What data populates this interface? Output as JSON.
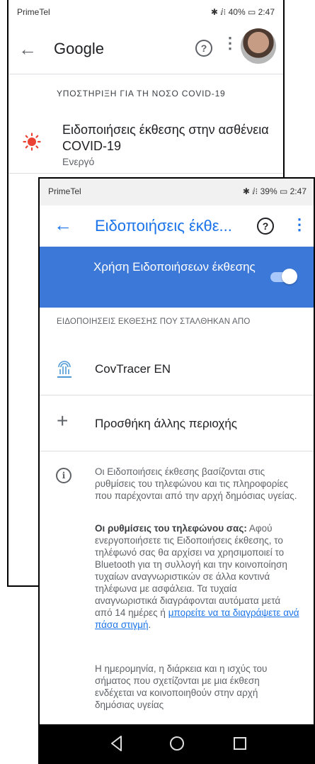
{
  "back_screen": {
    "status_bar": {
      "carrier": "PrimeTel",
      "right": "✱ ⅈ⁝ 40% ▭ 2:47"
    },
    "toolbar": {
      "back_icon": "arrow-left-icon",
      "title": "Google",
      "help_icon": "help-icon",
      "menu_icon": "more-vert-icon"
    },
    "section_heading": "ΥΠΟΣΤΗΡΙΞΗ ΓΙΑ ΤΗ ΝΟΣΟ COVID-19",
    "item": {
      "title": "Ειδοποιήσεις έκθεσης στην ασθένεια COVID-19",
      "status": "Ενεργό",
      "icon": "exposure-notification-icon"
    }
  },
  "front_screen": {
    "status_bar": {
      "carrier": "PrimeTel",
      "right": "✱ ⅈ⁝ 39% ▭ 2:47"
    },
    "toolbar": {
      "title": "Ειδοποιήσεις έκθε...",
      "help_label": "?",
      "accent": "#1a73e8"
    },
    "banner": {
      "label": "Χρήση Ειδοποιήσεων έκθεσης",
      "enabled": true,
      "color": "#3c78d8"
    },
    "section_caption": "ΕΙΔΟΠΟΙΗΣΕΙΣ ΕΚΘΕΣΗΣ ΠΟΥ ΣΤΑΛΘΗΚΑΝ ΑΠΟ",
    "apps": [
      {
        "name": "CovTracer EN",
        "icon": "covtracer-logo-icon"
      }
    ],
    "add_region": {
      "label": "Προσθήκη άλλης περιοχής"
    },
    "info": {
      "paragraph1": "Οι Ειδοποιήσεις έκθεσης βασίζονται στις ρυθμίσεις του τηλεφώνου και τις πληροφορίες που παρέχονται από την αρχή δημόσιας υγείας.",
      "paragraph2_bold": "Οι ρυθμίσεις του τηλεφώνου σας:",
      "paragraph2_text": "Αφού ενεργοποιήσετε τις Ειδοποιήσεις έκθεσης, το τηλέφωνό σας θα αρχίσει να χρησιμοποιεί το Bluetooth για τη συλλογή και την κοινοποίηση τυχαίων αναγνωριστικών σε άλλα κοντινά τηλέφωνα με ασφάλεια. Τα τυχαία αναγνωριστικά διαγράφονται αυτόματα μετά από 14 ημέρες ή",
      "paragraph2_link": "μπορείτε να τα διαγράψετε ανά πάσα στιγμή",
      "paragraph2_end": ".",
      "paragraph3": "Η ημερομηνία, η διάρκεια και η ισχύς του σήματος που σχετίζονται με μια έκθεση ενδέχεται να κοινοποιηθούν στην αρχή δημόσιας υγείας"
    },
    "nav_bar": {
      "back": "nav-back-icon",
      "home": "nav-home-icon",
      "recents": "nav-recents-icon"
    }
  }
}
